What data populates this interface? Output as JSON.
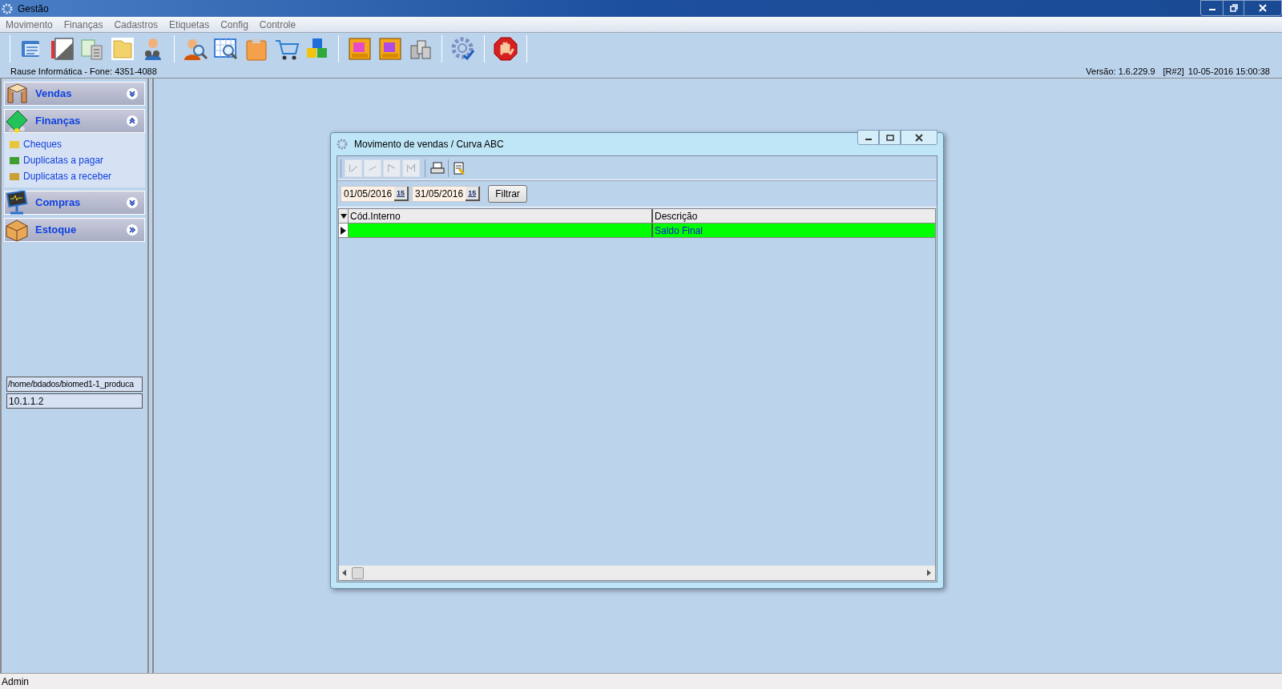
{
  "window": {
    "title": "Gestão"
  },
  "menu": [
    "Movimento",
    "Finanças",
    "Cadastros",
    "Etiquetas",
    "Config",
    "Controle"
  ],
  "info_bar": {
    "company": "Rause Informática - Fone: 4351-4088",
    "version": "Versão: 1.6.229.9",
    "release": "[R#2]",
    "timestamp": "10-05-2016 15:00:38"
  },
  "sidebar": {
    "sections": [
      {
        "label": "Vendas",
        "kind": "group",
        "expanded": false
      },
      {
        "label": "Finanças",
        "kind": "group",
        "expanded": true,
        "items": [
          "Cheques",
          "Duplicatas a pagar",
          "Duplicatas a receber"
        ]
      },
      {
        "label": "Compras",
        "kind": "group",
        "expanded": false
      },
      {
        "label": "Estoque",
        "kind": "shortcut"
      }
    ],
    "path": "/home/bdados/biomed1-1_produca",
    "address": "10.1.1.2"
  },
  "dialog": {
    "title": "Movimento de vendas / Curva ABC",
    "navigator": [
      {
        "kind": "first",
        "disabled": true
      },
      {
        "kind": "prior",
        "disabled": true
      },
      {
        "kind": "next",
        "disabled": true
      },
      {
        "kind": "last",
        "disabled": true
      }
    ],
    "dates": [
      {
        "value": "01/05/2016",
        "calendar_label": "15"
      },
      {
        "value": "31/05/2016",
        "calendar_label": "15"
      }
    ],
    "filter_button": "Filtrar",
    "columns": [
      "Cód.Interno",
      "Descrição"
    ],
    "rows": [
      {
        "selected": true,
        "descricao": "Saldo Final"
      }
    ]
  },
  "status_bar": "Admin"
}
